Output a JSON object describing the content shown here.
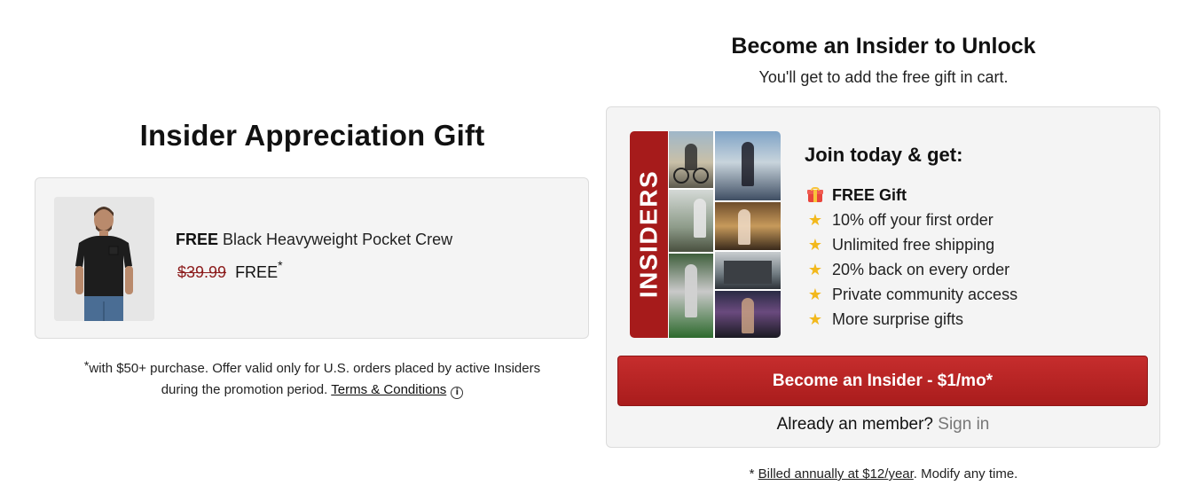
{
  "left": {
    "title": "Insider Appreciation Gift",
    "product": {
      "free_label": "FREE",
      "name": "Black Heavyweight Pocket Crew",
      "old_price": "$39.99",
      "new_price": "FREE",
      "asterisk": "*"
    },
    "disclaimer": {
      "asterisk": "*",
      "text_line1": "with $50+ purchase. Offer valid only for U.S. orders placed by active Insiders",
      "text_line2": "during the promotion period.",
      "terms_link": "Terms & Conditions",
      "info_glyph": "i"
    }
  },
  "right": {
    "title": "Become an Insider to Unlock",
    "subtitle": "You'll get to add the free gift in cart.",
    "collage_label": "INSIDERS",
    "join_title": "Join today & get:",
    "benefits": [
      {
        "icon": "gift-icon",
        "label": "FREE Gift"
      },
      {
        "icon": "star-icon",
        "label": "10% off your first order"
      },
      {
        "icon": "star-icon",
        "label": "Unlimited free shipping"
      },
      {
        "icon": "star-icon",
        "label": "20% back on every order"
      },
      {
        "icon": "star-icon",
        "label": "Private community access"
      },
      {
        "icon": "star-icon",
        "label": "More surprise gifts"
      }
    ],
    "cta_label": "Become an Insider - $1/mo*",
    "member_prompt": "Already an member?",
    "sign_in_label": "Sign in",
    "billing": {
      "prefix": "* ",
      "link": "Billed annually at $12/year",
      "suffix": ". Modify any time."
    }
  },
  "colors": {
    "brand_red": "#a61b1b",
    "cta_red": "#b82424",
    "star": "#f2b81c",
    "card_bg": "#f4f4f4"
  }
}
